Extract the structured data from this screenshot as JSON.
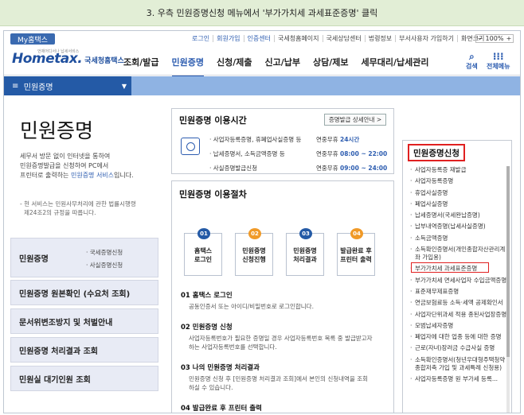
{
  "banner": {
    "text": "3. 우측 민원증명신청 메뉴에서 '부가가치세 과세표준증명' 클릭"
  },
  "topbar": {
    "my_tab": "My홈택스",
    "links": [
      "로그인",
      "회원가입",
      "인증센터",
      "국세청홈페이지",
      "국세상담센터",
      "법령정보",
      "부서사용자 가입하기",
      "화면크기"
    ],
    "zoom": "100%"
  },
  "header": {
    "logo_tag": "언제어디서나 납세서비스",
    "logo_main": "Hometax.",
    "logo_sub": "국세청홈택스",
    "nav": [
      "조회/발급",
      "민원증명",
      "신청/제출",
      "신고/납부",
      "상담/제보",
      "세무대리/납세관리"
    ],
    "search_label": "검색",
    "allmenu_label": "전체메뉴"
  },
  "bluebar": {
    "label": "민원증명",
    "menu_glyph": "≡",
    "arrow": "▼"
  },
  "left": {
    "title": "민원증명",
    "desc_1": "세무서 방문 없이 인터넷을 통하여",
    "desc_2": "민원증명발급을 신청하여 PC에서",
    "desc_3a": "프린터로 출력하는 ",
    "desc_3b": "민원증명 서비스",
    "desc_3c": "입니다.",
    "note_1": "- 현 서비스는 민원사무처리에 관한 법률시행령",
    "note_2": "제24조2의 규정을 따릅니다.",
    "menu": [
      {
        "label": "민원증명",
        "subs": [
          "· 국세증명신청",
          "· 사실증명신청"
        ]
      },
      {
        "label": "민원증명 원본확인 (수요처 조회)"
      },
      {
        "label": "문서위변조방지 및 처벌안내"
      },
      {
        "label": "민원증명 처리결과 조회"
      },
      {
        "label": "민원실 대기인원 조회"
      }
    ]
  },
  "hours": {
    "title": "민원증명 이용시간",
    "detail_button": "증명발급 상세안내 >",
    "rows": [
      {
        "label": "· 사업자등록증명, 휴폐업사실증명 등",
        "value_prefix": "연중무휴 ",
        "value": "24시간"
      },
      {
        "label": "· 납세증명서, 소득금액증명 등",
        "value_prefix": "연중무휴 ",
        "value": "08:00 ~ 22:00"
      },
      {
        "label": "· 사실증명발급신청",
        "value_prefix": "연중무휴 ",
        "value": "09:00 ~ 24:00"
      }
    ]
  },
  "procedure": {
    "title": "민원증명 이용절차",
    "steps": [
      {
        "num": "01",
        "line1": "홈택스",
        "line2": "로그인"
      },
      {
        "num": "02",
        "line1": "민원증명",
        "line2": "신청진행"
      },
      {
        "num": "03",
        "line1": "민원증명",
        "line2": "처리결과"
      },
      {
        "num": "04",
        "line1": "발급완료 후",
        "line2": "프린터 출력"
      }
    ],
    "sections": [
      {
        "title": "01 홈택스 로그인",
        "desc": [
          "공동인증서 또는 아이디/비밀번호로 로그인합니다."
        ]
      },
      {
        "title": "02 민원증명 신청",
        "desc": [
          "사업자등록번호가 필요한 증명일 경우 사업자등록번호 목록 중 발급받고자",
          "하는 사업자등록번호를 선택합니다."
        ]
      },
      {
        "title": "03 나의 민원증명 처리결과",
        "desc": [
          "민원증명 신청 후 [민원증명 처리결과 조회]에서 본인의 신청내역을 조회",
          "하실 수 있습니다."
        ]
      },
      {
        "title": "04 발급완료 후 프린터 출력",
        "desc": []
      }
    ]
  },
  "right": {
    "title": "민원증명신청",
    "items": [
      "사업자등록증 재발급",
      "사업자등록증명",
      "휴업사실증명",
      "폐업사실증명",
      "납세증명서(국세완납증명)",
      "납부내역증명(납세사실증명)",
      "소득금액증명",
      "소득확인증명서(개인종합자산관리계좌 가입용)",
      "부가가치세 과세표준증명",
      "부가가치세 면세사업자 수입금액증명",
      "표준재무제표증명",
      "연금보험료등 소득·세액 공제확인서",
      "사업자단위과세 적용 종된사업장증명",
      "모범납세자증명",
      "폐업자에 대한 업종 등에 대한 증명",
      "근로(자녀)장려금 수급사실 증명",
      "소득확인증명서(청년우대형주택청약종합저축 가입 및 과세특례 신청용)",
      "사업자등록증명 원 부가세 등록..."
    ],
    "items_display": [
      "사업자등록증 재발급",
      "사업자등록증명",
      "휴업사실증명",
      "폐업사실증명",
      "납세증명서(국세완납증명)",
      "납부내역증명(납세사실증명)",
      "소득금액증명",
      "소득확인증명서(개인종합자산관리계좌 가입용)",
      "부가가치세 과세표준증명",
      "부가가치세 면세사업자 수입금액증명",
      "표준재무제표증명",
      "연금보험료등 소득·세액 공제확인서",
      "사업자단위과세 적용 종된사업장증명",
      "모범납세자증명",
      "폐업자에 대한 업종 등에 대한 증명",
      "근로(자녀)장려금 수급사실 증명",
      "소득확인증명서(청년우대형주택청약종합저축 가입 및 과세특례 신청용)",
      "사업자등록증명 원 부가세 등록..."
    ],
    "highlighted": "부가가치세 과세표준증명"
  },
  "colors": {
    "accent": "#245aa6",
    "highlight": "#e02020",
    "banner_bg": "#e2eed6"
  }
}
